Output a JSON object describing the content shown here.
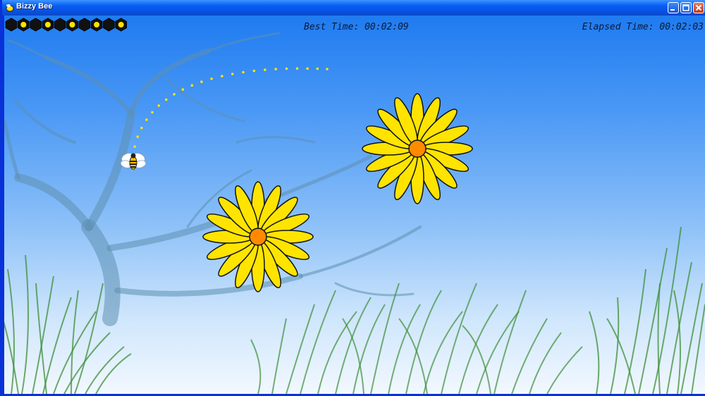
{
  "window": {
    "title": "Bizzy Bee"
  },
  "hud": {
    "best_label": "Best Time:",
    "best_value": "00:02:09",
    "elapsed_label": "Elapsed Time:",
    "elapsed_value": "00:02:03",
    "honeycomb_cells_total": 10,
    "honeycomb_cells_filled": 5
  },
  "colors": {
    "petal": "#ffe400",
    "flower_center": "#ff8a00",
    "sky_top": "#1f7bf0",
    "grass": "#3d8f3a",
    "trail": "#ffe400"
  },
  "icons": [
    "bee-icon",
    "minimize-icon",
    "maximize-icon",
    "close-icon"
  ]
}
